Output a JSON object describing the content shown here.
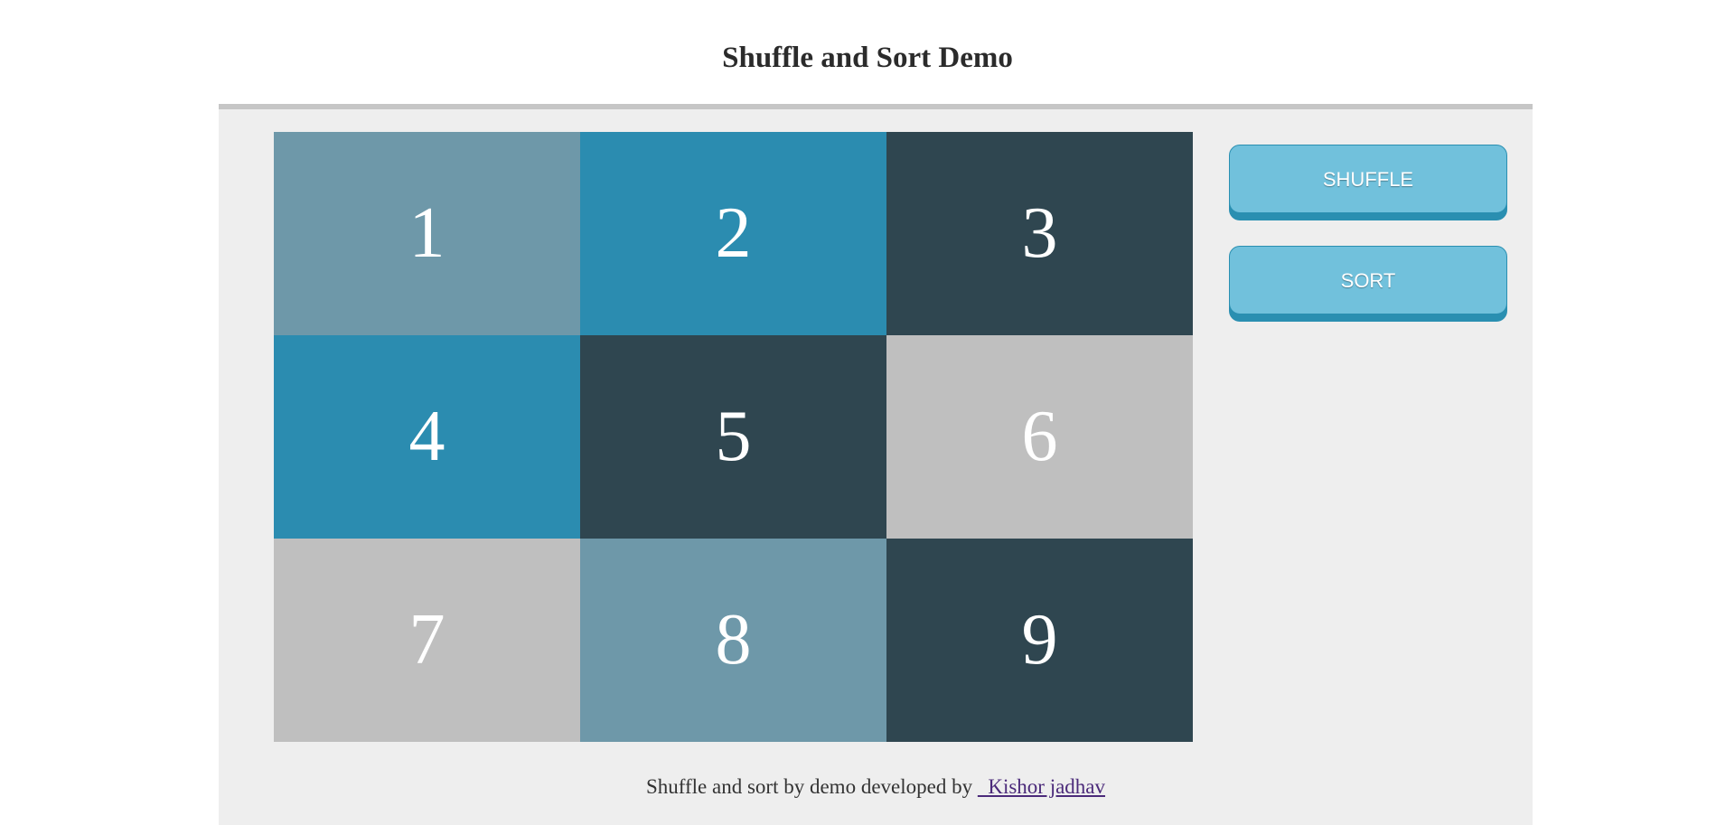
{
  "page": {
    "title": "Shuffle and Sort Demo"
  },
  "tiles": [
    {
      "label": "1",
      "color": "#6e98a9"
    },
    {
      "label": "2",
      "color": "#2b8cb0"
    },
    {
      "label": "3",
      "color": "#2f4650"
    },
    {
      "label": "4",
      "color": "#2b8cb0"
    },
    {
      "label": "5",
      "color": "#2f4650"
    },
    {
      "label": "6",
      "color": "#bfbfbf"
    },
    {
      "label": "7",
      "color": "#bfbfbf"
    },
    {
      "label": "8",
      "color": "#6e98a9"
    },
    {
      "label": "9",
      "color": "#2f4650"
    }
  ],
  "controls": {
    "shuffle_label": "SHUFFLE",
    "sort_label": "SORT"
  },
  "footer": {
    "text": "Shuffle and sort by demo developed by ",
    "link_text": "  Kishor jadhav"
  }
}
